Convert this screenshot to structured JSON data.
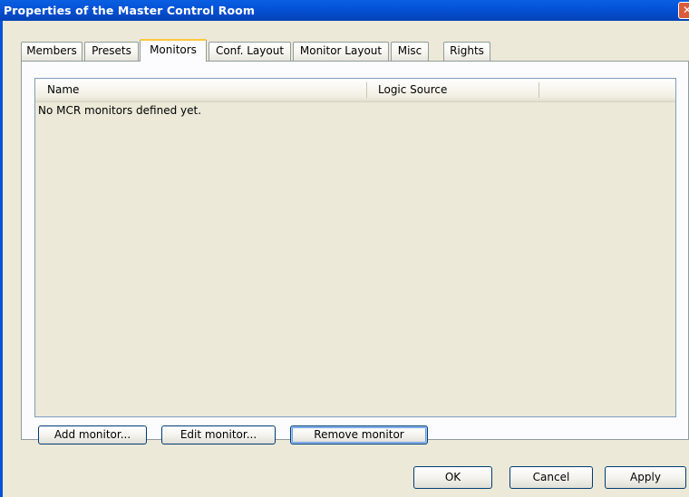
{
  "window": {
    "title": "Properties of the Master Control Room",
    "close_glyph": "✕"
  },
  "tabs": [
    {
      "label": "Members"
    },
    {
      "label": "Presets"
    },
    {
      "label": "Monitors"
    },
    {
      "label": "Conf. Layout"
    },
    {
      "label": "Monitor Layout"
    },
    {
      "label": "Misc"
    },
    {
      "label": "Rights"
    }
  ],
  "active_tab": "Monitors",
  "monitors_list": {
    "columns": [
      "Name",
      "Logic Source"
    ],
    "empty_message": "No MCR monitors defined yet."
  },
  "panel_buttons": {
    "add": "Add monitor...",
    "edit": "Edit monitor...",
    "remove": "Remove monitor"
  },
  "dialog_buttons": {
    "ok": "OK",
    "cancel": "Cancel",
    "apply": "Apply"
  }
}
